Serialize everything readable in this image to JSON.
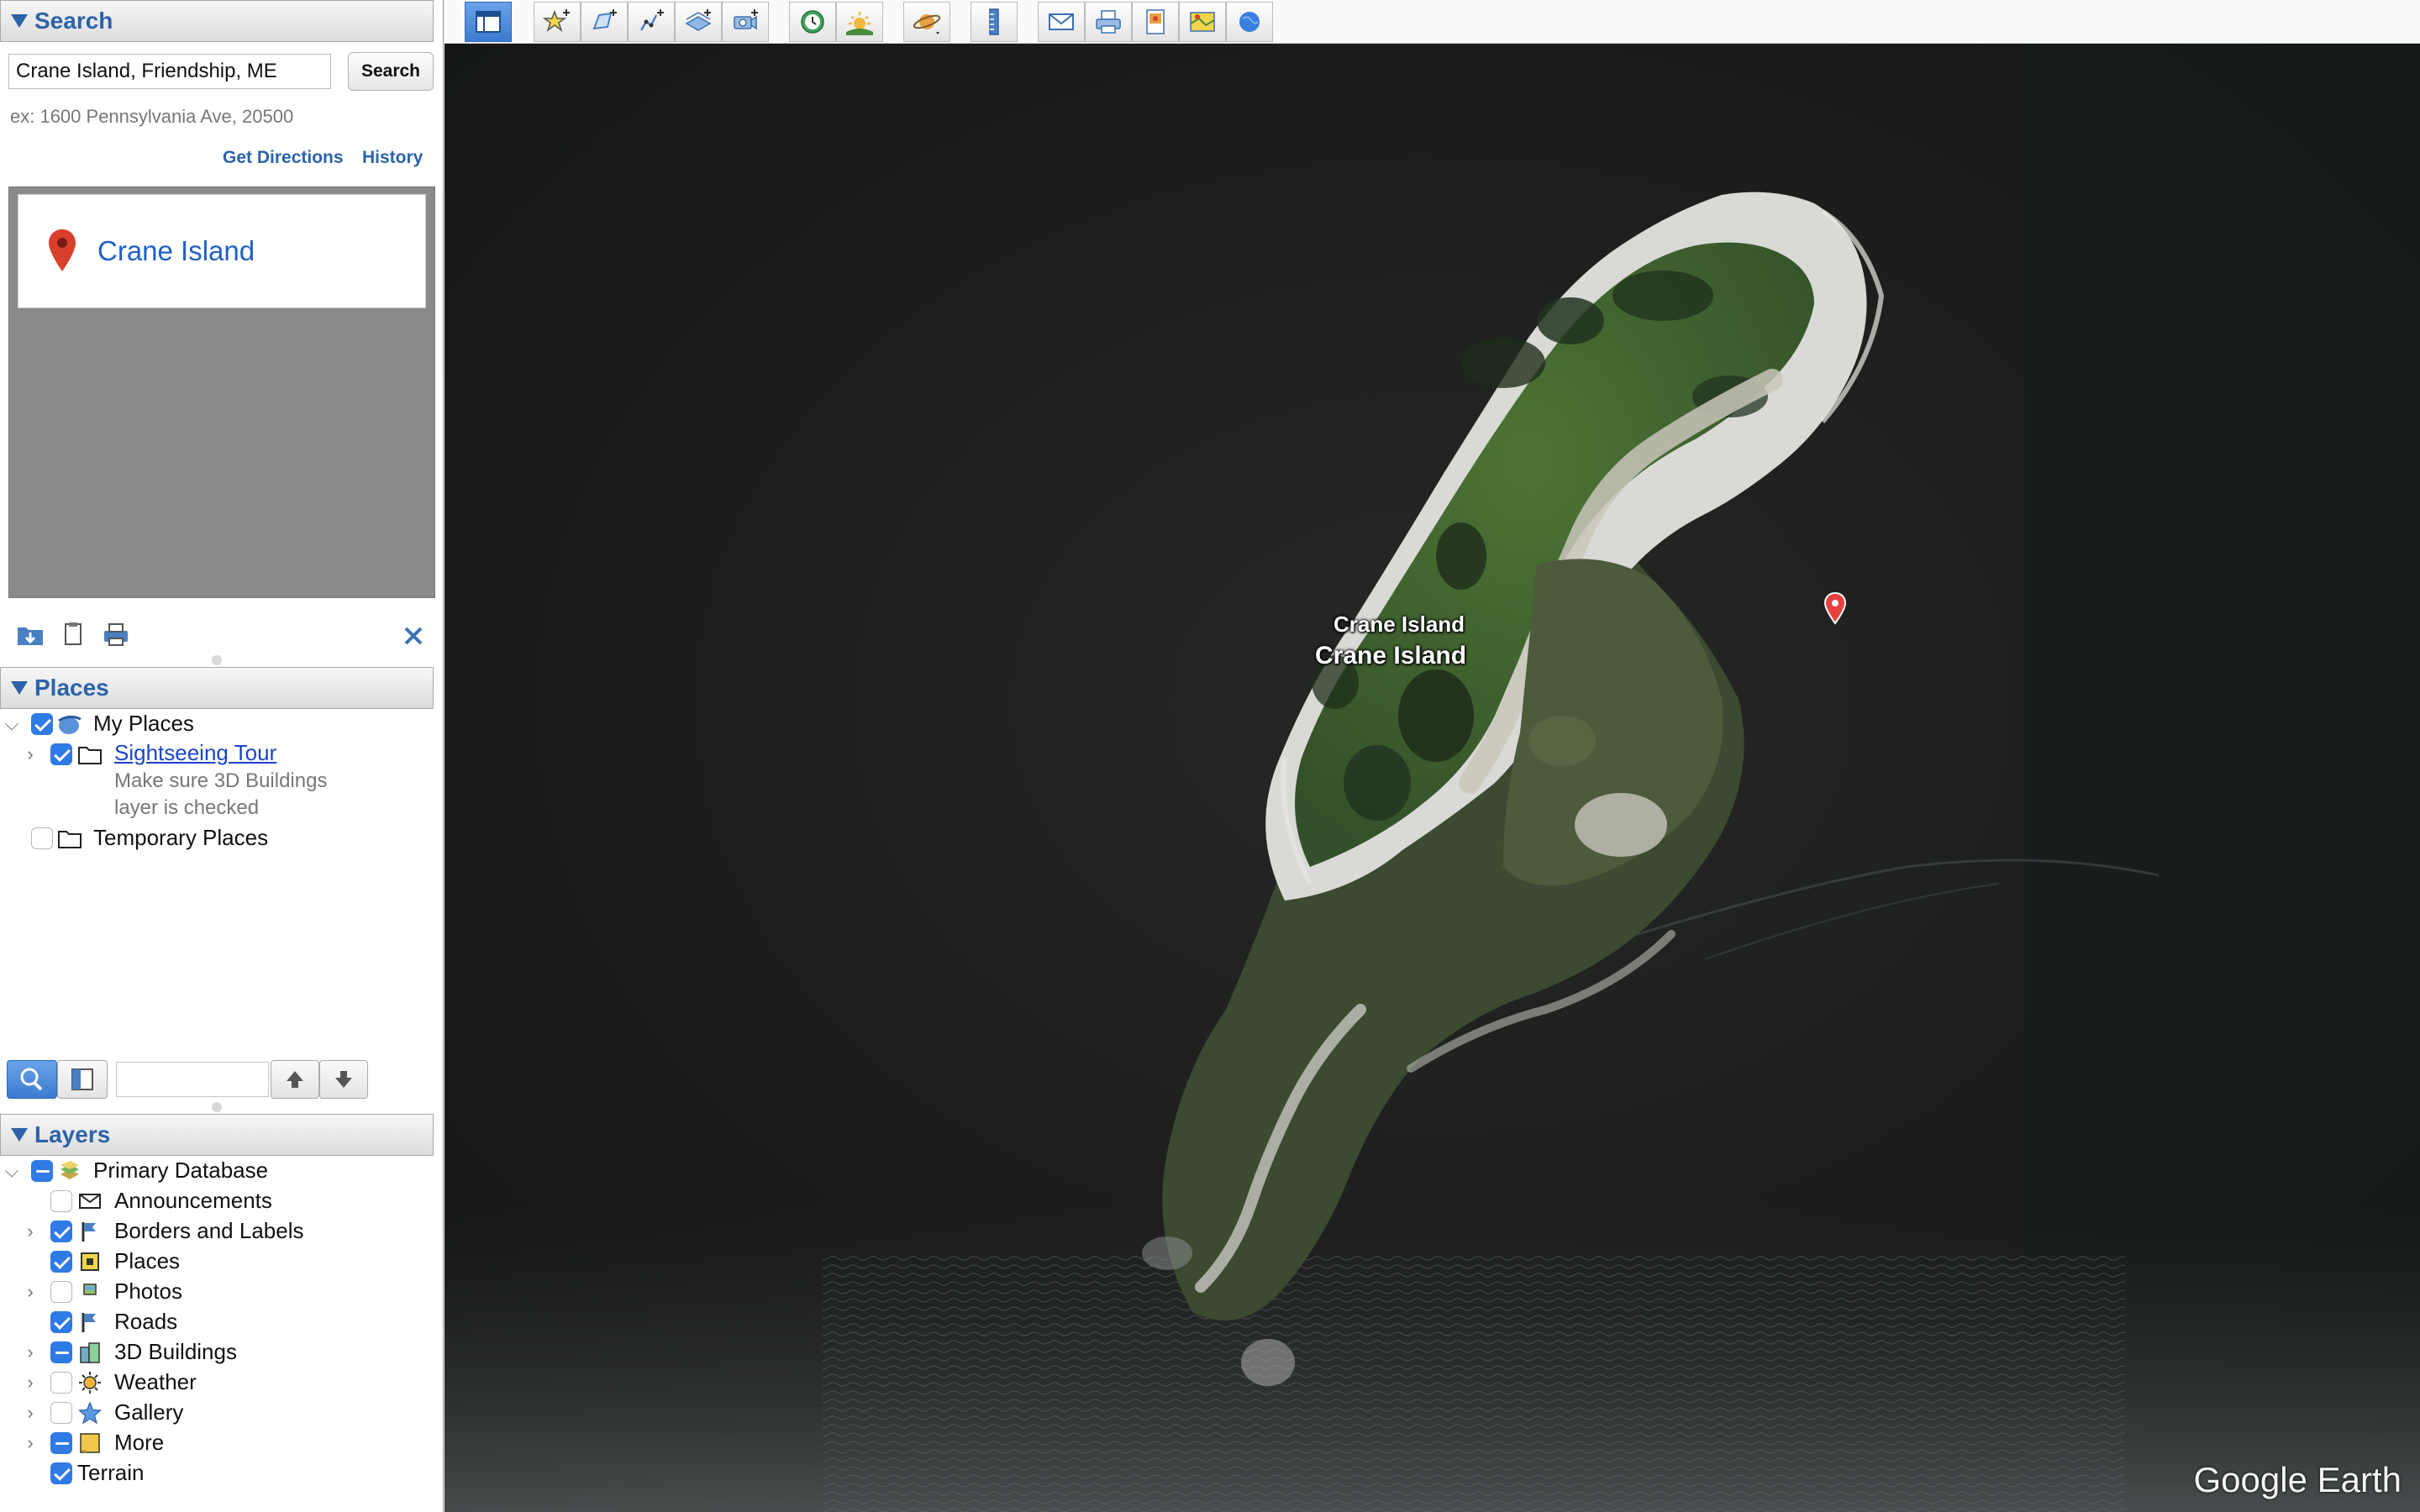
{
  "search": {
    "header": "Search",
    "query": "Crane Island, Friendship, ME",
    "button": "Search",
    "example": "ex: 1600 Pennsylvania Ave, 20500",
    "get_directions": "Get Directions",
    "history": "History",
    "result_title": "Crane Island"
  },
  "places": {
    "header": "Places",
    "my_places": "My Places",
    "sightseeing_tour": "Sightseeing Tour",
    "tour_desc_1": "Make sure 3D Buildings",
    "tour_desc_2": "layer is checked",
    "temporary_places": "Temporary Places"
  },
  "layers": {
    "header": "Layers",
    "items": [
      {
        "label": "Primary Database",
        "state": "mixed"
      },
      {
        "label": "Announcements",
        "state": "off"
      },
      {
        "label": "Borders and Labels",
        "state": "on"
      },
      {
        "label": "Places",
        "state": "on"
      },
      {
        "label": "Photos",
        "state": "off"
      },
      {
        "label": "Roads",
        "state": "on"
      },
      {
        "label": "3D Buildings",
        "state": "mixed"
      },
      {
        "label": "Weather",
        "state": "off"
      },
      {
        "label": "Gallery",
        "state": "off"
      },
      {
        "label": "More",
        "state": "mixed"
      },
      {
        "label": "Terrain",
        "state": "on"
      }
    ]
  },
  "map": {
    "label_small": "Crane Island",
    "label_large": "Crane Island",
    "logo": "Google Earth"
  },
  "colors": {
    "accent": "#2c63a8",
    "checkbox": "#2f7ae5",
    "link": "#2160c8"
  }
}
